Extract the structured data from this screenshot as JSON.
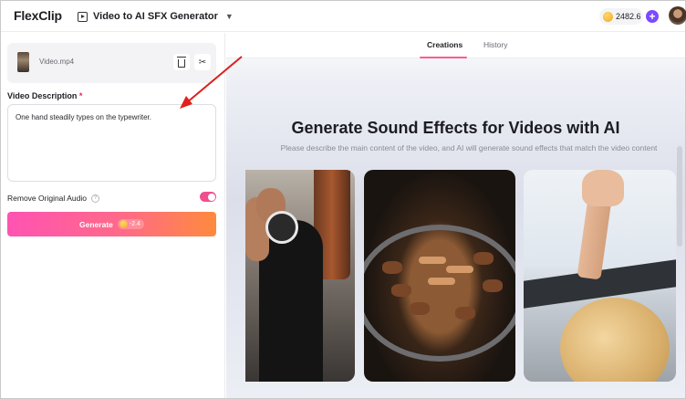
{
  "app": {
    "logo_text": "FlexClip",
    "tool_name": "Video to AI SFX Generator",
    "credits": "2482.6"
  },
  "left_panel": {
    "video_file": "Video.mp4",
    "description_label": "Video Description",
    "required_mark": "*",
    "description_value": "One hand steadily types on the typewriter.",
    "remove_audio_label": "Remove Original Audio",
    "remove_audio_enabled": true,
    "generate_label": "Generate",
    "generate_cost": "-2.4"
  },
  "main": {
    "tabs": [
      {
        "label": "Creations",
        "active": true
      },
      {
        "label": "History",
        "active": false
      }
    ],
    "title": "Generate Sound Effects for Videos with AI",
    "subtitle": "Please describe the main content of the video, and AI will generate sound effects that match the video content"
  },
  "colors": {
    "accent": "#7a4bff",
    "generate_gradient_start": "#ff53b3",
    "generate_gradient_end": "#ff8a3d",
    "toggle_on": "#f04f8d",
    "annotation_arrow": "#e0201b"
  }
}
